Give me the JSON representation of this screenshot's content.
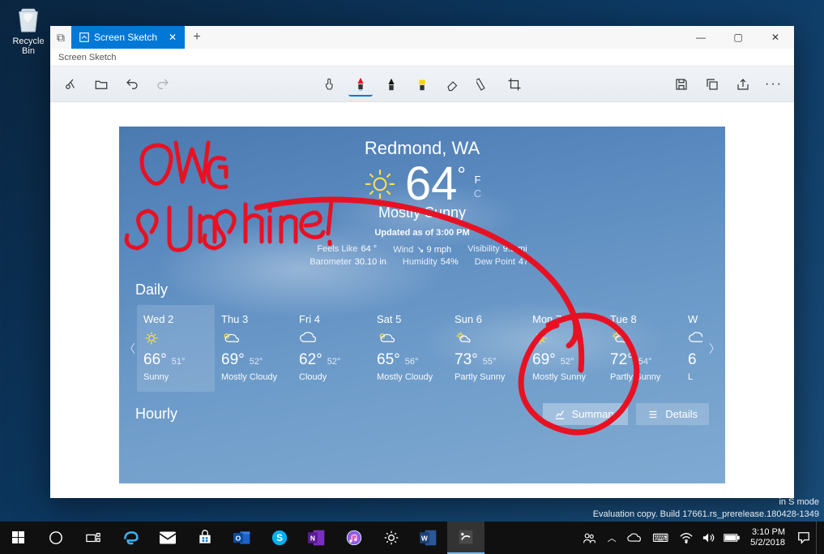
{
  "desktop": {
    "recycle_bin": "Recycle Bin"
  },
  "window": {
    "tab_title": "Screen Sketch",
    "subtitle": "Screen Sketch",
    "controls": {
      "min": "—",
      "max": "▢",
      "close": "✕"
    },
    "toolbar": {
      "new": "new-snip",
      "open": "open",
      "undo": "undo",
      "redo": "redo",
      "touch": "touch-writing",
      "pen_red": "pen-red",
      "pen_black": "pen-black",
      "highlighter": "highlighter",
      "eraser": "eraser",
      "ruler": "ruler",
      "crop": "crop",
      "save": "save",
      "copy": "copy",
      "share": "share",
      "more": "more"
    }
  },
  "weather": {
    "location": "Redmond, WA",
    "temp": "64",
    "unit_f": "F",
    "unit_c": "C",
    "condition": "Mostly Sunny",
    "updated": "Updated as of 3:00 PM",
    "stats": {
      "feels": {
        "lbl": "Feels Like",
        "val": "64 °"
      },
      "wind": {
        "lbl": "Wind",
        "val": "9 mph"
      },
      "vis": {
        "lbl": "Visibility",
        "val": "9.9 mi"
      },
      "baro": {
        "lbl": "Barometer",
        "val": "30.10 in"
      },
      "hum": {
        "lbl": "Humidity",
        "val": "54%"
      },
      "dew": {
        "lbl": "Dew Point",
        "val": "47 °"
      }
    },
    "daily_label": "Daily",
    "hourly_label": "Hourly",
    "summary_btn": "Summary",
    "details_btn": "Details",
    "days": [
      {
        "name": "Wed 2",
        "hi": "66°",
        "lo": "51°",
        "cond": "Sunny",
        "icon": "sun"
      },
      {
        "name": "Thu 3",
        "hi": "69°",
        "lo": "52°",
        "cond": "Mostly Cloudy",
        "icon": "mcloud"
      },
      {
        "name": "Fri 4",
        "hi": "62°",
        "lo": "52°",
        "cond": "Cloudy",
        "icon": "cloud"
      },
      {
        "name": "Sat 5",
        "hi": "65°",
        "lo": "56°",
        "cond": "Mostly Cloudy",
        "icon": "mcloud"
      },
      {
        "name": "Sun 6",
        "hi": "73°",
        "lo": "55°",
        "cond": "Partly Sunny",
        "icon": "pcloud"
      },
      {
        "name": "Mon 7",
        "hi": "69°",
        "lo": "52°",
        "cond": "Mostly Sunny",
        "icon": "sun"
      },
      {
        "name": "Tue 8",
        "hi": "72°",
        "lo": "54°",
        "cond": "Partly Sunny",
        "icon": "pcloud"
      },
      {
        "name": "W",
        "hi": "6",
        "lo": "",
        "cond": "L",
        "icon": "cloud"
      }
    ]
  },
  "annotation": {
    "text": "OMG Sunshine!"
  },
  "taskbar": {
    "time": "3:10 PM",
    "date": "5/2/2018"
  },
  "watermark": {
    "l1": "in S mode",
    "l2": "Evaluation copy. Build 17661.rs_prerelease.180428-1349"
  }
}
